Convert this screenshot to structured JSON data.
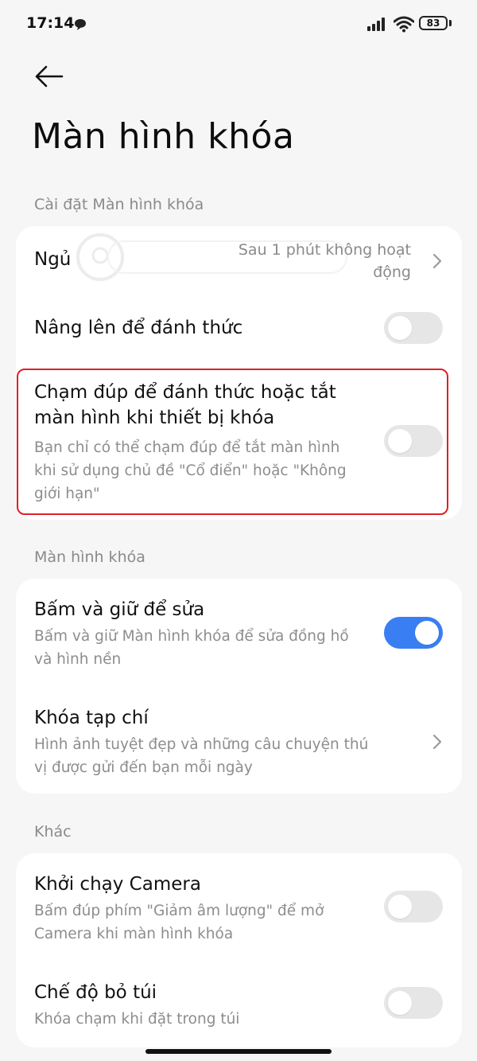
{
  "status_bar": {
    "time": "17:14",
    "battery": "83"
  },
  "header": {
    "title": "Màn hình khóa"
  },
  "sections": [
    {
      "label": "Cài đặt Màn hình khóa"
    },
    {
      "label": "Màn hình khóa"
    },
    {
      "label": "Khác"
    }
  ],
  "items": {
    "sleep": {
      "title": "Ngủ",
      "value_line1": "Sau 1 phút không hoạt",
      "value_line2": "động"
    },
    "raise_to_wake": {
      "title": "Nâng lên để đánh thức",
      "enabled": false
    },
    "double_tap": {
      "title_line1": "Chạm đúp để đánh thức hoặc tắt",
      "title_line2": "màn hình khi thiết bị khóa",
      "sub_line1": "Bạn chỉ có thể chạm đúp để tắt màn hình",
      "sub_line2": "khi sử dụng chủ đề \"Cổ điển\" hoặc \"Không",
      "sub_line3": "giới hạn\"",
      "enabled": false
    },
    "press_hold_edit": {
      "title": "Bấm và giữ để sửa",
      "sub_line1": "Bấm và giữ Màn hình khóa để sửa đồng hồ",
      "sub_line2": "và hình nền",
      "enabled": true
    },
    "magazine": {
      "title": "Khóa tạp chí",
      "sub_line1": "Hình ảnh tuyệt đẹp và những câu chuyện thú",
      "sub_line2": "vị được gửi đến bạn mỗi ngày"
    },
    "camera": {
      "title": "Khởi chạy Camera",
      "sub_line1": "Bấm đúp phím \"Giảm âm lượng\" để mở",
      "sub_line2": "Camera khi màn hình khóa",
      "enabled": false
    },
    "pocket": {
      "title": "Chế độ bỏ túi",
      "sub": "Khóa chạm khi đặt trong túi",
      "enabled": false
    }
  },
  "colors": {
    "accent": "#3a7ef3",
    "highlight": "#e01f26"
  }
}
